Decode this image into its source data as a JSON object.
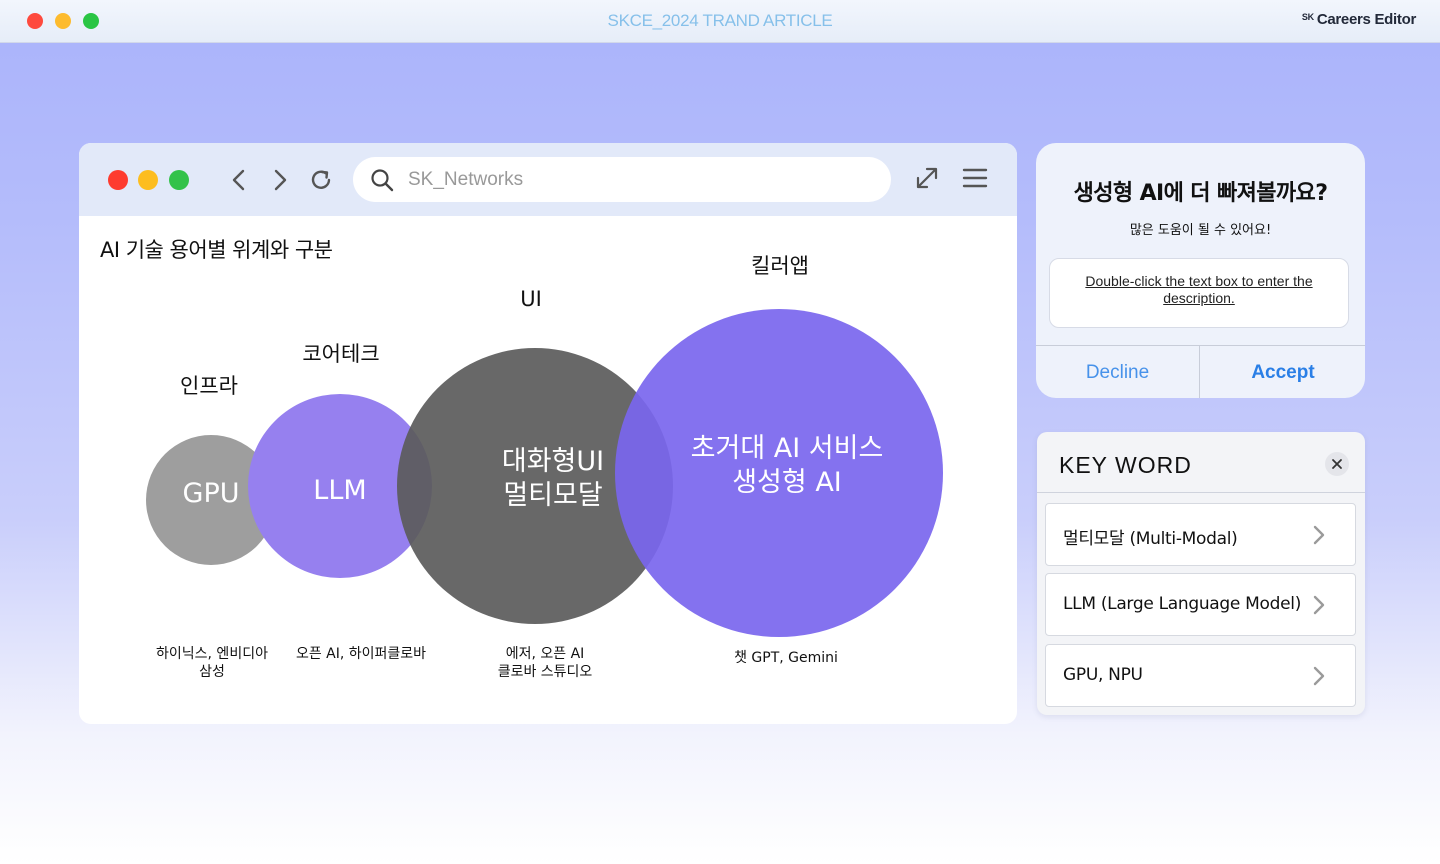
{
  "window": {
    "title": "SKCE_2024 TRAND ARTICLE",
    "brand_prefix": "SK",
    "brand_name": "Careers Editor"
  },
  "browser": {
    "search_value": "SK_Networks"
  },
  "diagram": {
    "title": "AI 기술 용어별 위계와 구분",
    "circles": [
      {
        "category": "인프라",
        "label_lines": [
          "GPU"
        ],
        "examples": [
          "하이닉스, 엔비디아",
          "삼성"
        ],
        "color": "#9e9e9e"
      },
      {
        "category": "코어테크",
        "label_lines": [
          "LLM"
        ],
        "examples": [
          "오픈 AI, 하이퍼클로바"
        ],
        "color": "#9680ef"
      },
      {
        "category": "UI",
        "label_lines": [
          "대화형UI",
          "멀티모달"
        ],
        "examples": [
          "에저, 오픈 AI",
          "클로바 스튜디오"
        ],
        "color": "#5b5b5b"
      },
      {
        "category": "킬러앱",
        "label_lines": [
          "초거대 AI 서비스",
          "생성형 AI"
        ],
        "examples": [
          "챗 GPT, Gemini"
        ],
        "color": "#7a66ee"
      }
    ]
  },
  "popup": {
    "title": "생성형 AI에 더 빠져볼까요?",
    "subtitle": "많은 도움이 될 수 있어요!",
    "box_text": "Double-click the text box to enter the description.",
    "decline_label": "Decline",
    "accept_label": "Accept"
  },
  "keywords": {
    "title": "KEY WORD",
    "items": [
      {
        "label": "멀티모달 (Multi-Modal)"
      },
      {
        "label": "LLM (Large Language Model)"
      },
      {
        "label": "GPU, NPU"
      }
    ]
  }
}
